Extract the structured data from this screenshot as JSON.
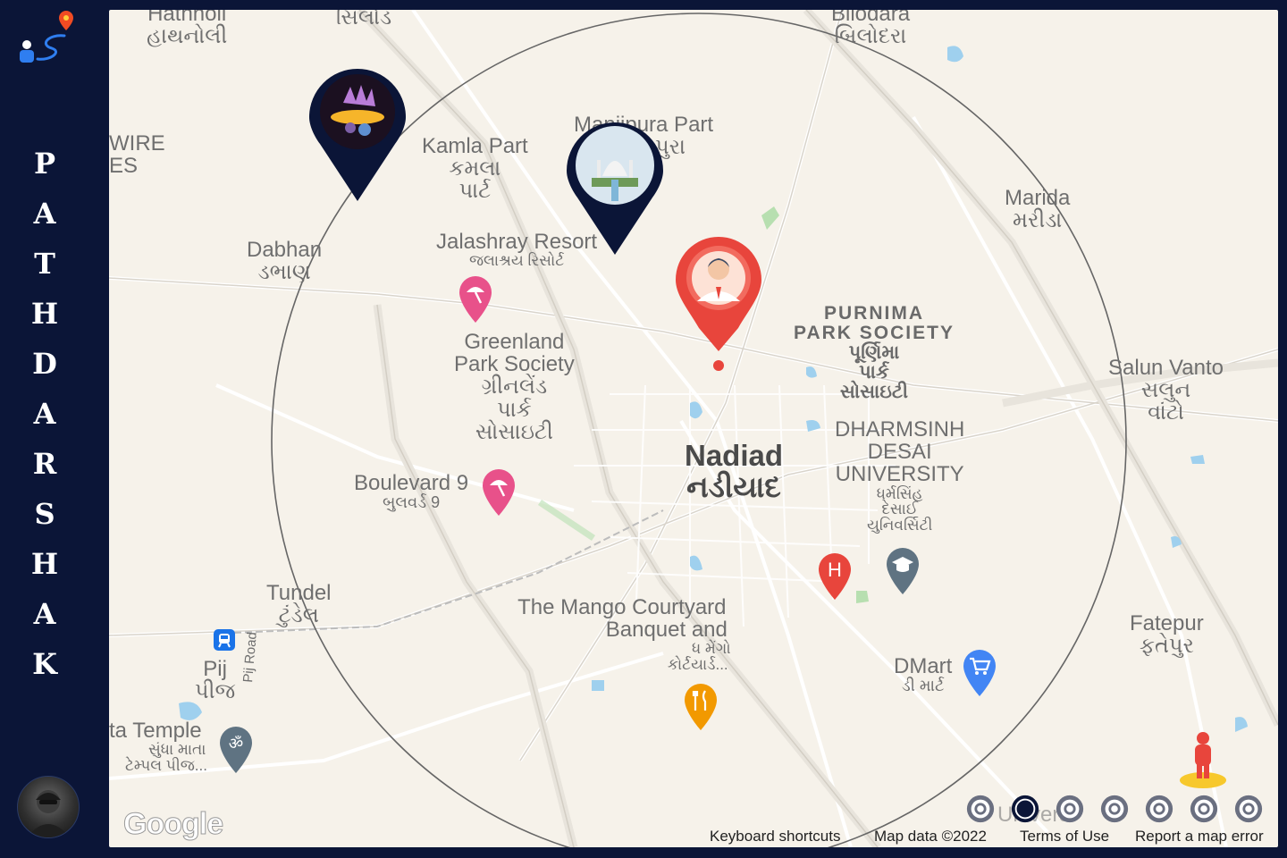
{
  "app": {
    "title_letters": [
      "P",
      "A",
      "T",
      "H",
      "D",
      "A",
      "R",
      "S",
      "H",
      "A",
      "K"
    ],
    "logo_icon": "route-pin-icon",
    "avatar_icon": "user-avatar"
  },
  "map": {
    "places": {
      "hathnoli_en": "Hathnoli",
      "hathnoli_gu": "હાથનોલી",
      "sihol_gu": "સિલોડ",
      "bilodra_en": "Bilodara",
      "bilodra_gu": "બિલોદરા",
      "kamla_en": "Kamla Part",
      "kamla_gu1": "કમલા",
      "kamla_gu2": "પાર્ટ",
      "manjipura_en": "Manjipura Part",
      "manjipura_gu": "પુરા",
      "wire": "WIRE",
      "es": "ES",
      "dabhan_en": "Dabhan",
      "dabhan_gu": "ડભાણ",
      "jalashray_en": "Jalashray Resort",
      "jalashray_gu": "જલાશ્રય રિસોર્ટ",
      "marida_en": "Marida",
      "marida_gu": "મરીડા",
      "greenland_1": "Greenland",
      "greenland_2": "Park Society",
      "greenland_gu1": "ગ્રીનલેંડ",
      "greenland_gu2": "પાર્ક",
      "greenland_gu3": "સોસાઇટી",
      "purnima_1": "PURNIMA",
      "purnima_2": "PARK SOCIETY",
      "purnima_gu1": "પૂર્ણિમા",
      "purnima_gu2": "પાર્ક",
      "purnima_gu3": "સોસાઇટી",
      "salun_en": "Salun Vanto",
      "salun_gu1": "સલુન",
      "salun_gu2": "વાંટો",
      "nadiad_en": "Nadiad",
      "nadiad_gu": "નડીયાદ",
      "ddu_1": "DHARMSINH",
      "ddu_2": "DESAI",
      "ddu_3": "UNIVERSITY",
      "ddu_gu1": "ધર્મસિંહ",
      "ddu_gu2": "દેસાઈ",
      "ddu_gu3": "યુનિવર્સિટી",
      "boulevard_en": "Boulevard 9",
      "boulevard_gu": "બુલવર્ડ 9",
      "tundel_en": "Tundel",
      "tundel_gu": "ટુંડેલ",
      "mango_1": "The Mango Courtyard",
      "mango_2": "Banquet and",
      "mango_gu1": "ધ મેંગો",
      "mango_gu2": "કોર્ટયાર્ડ...",
      "fatepur_en": "Fatepur",
      "fatepur_gu": "ફતેપુર",
      "dmart_en": "DMart",
      "dmart_gu": "ડી માર્ટ",
      "pij_en": "Pij",
      "pij_gu": "પીજ",
      "pij_road": "Pij Road",
      "temple_en": "ta Temple",
      "temple_gu1": "સુંધા માતા",
      "temple_gu2": "ટેમ્પલ પીજ...",
      "university_partial": "Universi"
    },
    "footer": {
      "google": "Google",
      "keyboard": "Keyboard shortcuts",
      "mapdata": "Map data ©2022",
      "terms": "Terms of Use",
      "report": "Report a map error"
    },
    "colors": {
      "navy": "#0b1537",
      "user_pin": "#e8453c",
      "poi_pink": "#e8518a",
      "hospital": "#e8453c",
      "food": "#f29900",
      "shop": "#4285f4",
      "edu": "#5f7382"
    }
  }
}
